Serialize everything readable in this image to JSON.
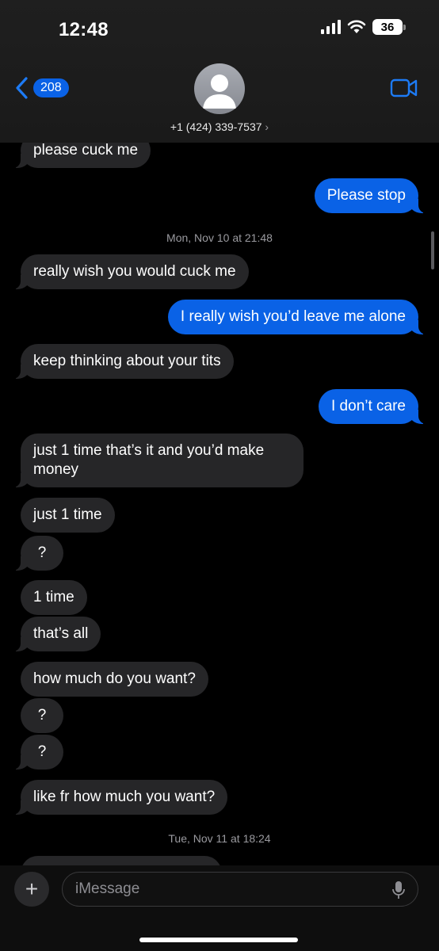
{
  "status": {
    "time": "12:48",
    "battery": "36"
  },
  "header": {
    "back_count": "208",
    "contact": "+1 (424) 339-7537",
    "chevron": "›"
  },
  "messages": [
    {
      "text": "please cuck me",
      "side": "in"
    },
    {
      "text": "Please stop",
      "side": "out"
    },
    {
      "text": "really wish you would cuck me",
      "side": "in"
    },
    {
      "text": "I really wish you’d leave me alone",
      "side": "out"
    },
    {
      "text": "keep thinking about your tits",
      "side": "in"
    },
    {
      "text": "I don’t care",
      "side": "out"
    },
    {
      "text": "just 1 time that’s it and you’d make",
      "text2": "money",
      "side": "in"
    },
    {
      "text": "just 1 time",
      "side": "in"
    },
    {
      "text": "?",
      "side": "in"
    },
    {
      "text": "1 time",
      "side": "in"
    },
    {
      "text": "that’s all",
      "side": "in"
    },
    {
      "text": "how much do you want?",
      "side": "in"
    },
    {
      "text": "?",
      "side": "in"
    },
    {
      "text": "?",
      "side": "in"
    },
    {
      "text": "like fr how much you want?",
      "side": "in"
    }
  ],
  "timestamps": [
    {
      "day": "Mon, Nov 10",
      "at": "at",
      "time": "21:48"
    },
    {
      "day": "Tue, Nov 11",
      "at": "at",
      "time": "18:24"
    }
  ],
  "composer": {
    "placeholder": "iMessage",
    "plus": "+"
  },
  "colors": {
    "incoming": "#262628",
    "outgoing": "#0a62e6",
    "background": "#000000"
  }
}
